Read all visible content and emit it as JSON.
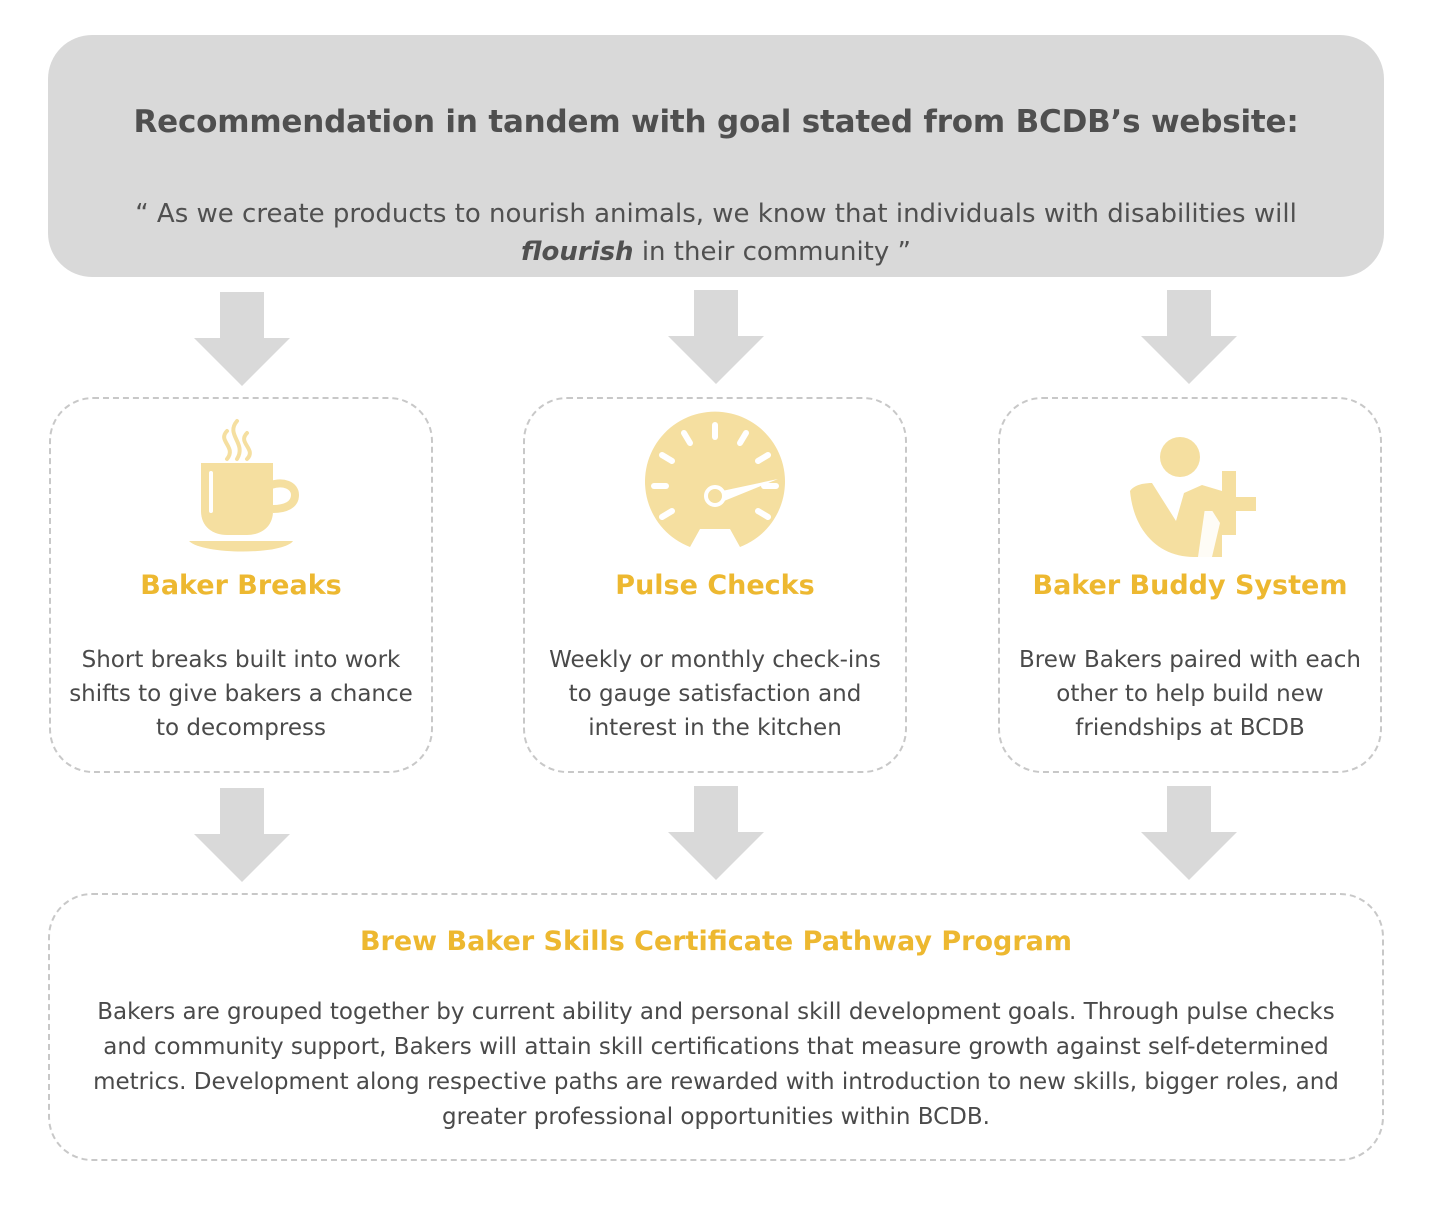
{
  "header": {
    "title": "Recommendation in tandem with goal stated from BCDB’s website:",
    "quote_open": "“ As we create products to nourish animals, we know that individuals with disabilities will ",
    "quote_emphasis": "flourish",
    "quote_close": " in their community ”"
  },
  "cards": [
    {
      "icon": "coffee-cup-icon",
      "title": "Baker Breaks",
      "description": "Short breaks built into work shifts to give bakers a chance to decompress"
    },
    {
      "icon": "speedometer-icon",
      "title": "Pulse Checks",
      "description": "Weekly or monthly check-ins to gauge satisfaction and interest in the kitchen"
    },
    {
      "icon": "add-user-icon",
      "title": "Baker Buddy System",
      "description": "Brew Bakers paired with each other to help build new friendships at BCDB"
    }
  ],
  "program": {
    "title": "Brew Baker Skills Certificate Pathway Program",
    "description": "Bakers are grouped together by current ability and personal skill development goals. Through pulse checks and community support, Bakers will attain skill certifications that measure growth against self-determined metrics. Development along respective paths are rewarded with introduction to new skills, bigger roles, and greater professional opportunities within BCDB."
  },
  "colors": {
    "header_bg": "#d9d9d9",
    "accent": "#edb830",
    "icon_fill": "#f5dfa0",
    "arrow": "#d9d9d9",
    "text": "#4a4a4a",
    "dashed_border": "#c8c8c8"
  }
}
